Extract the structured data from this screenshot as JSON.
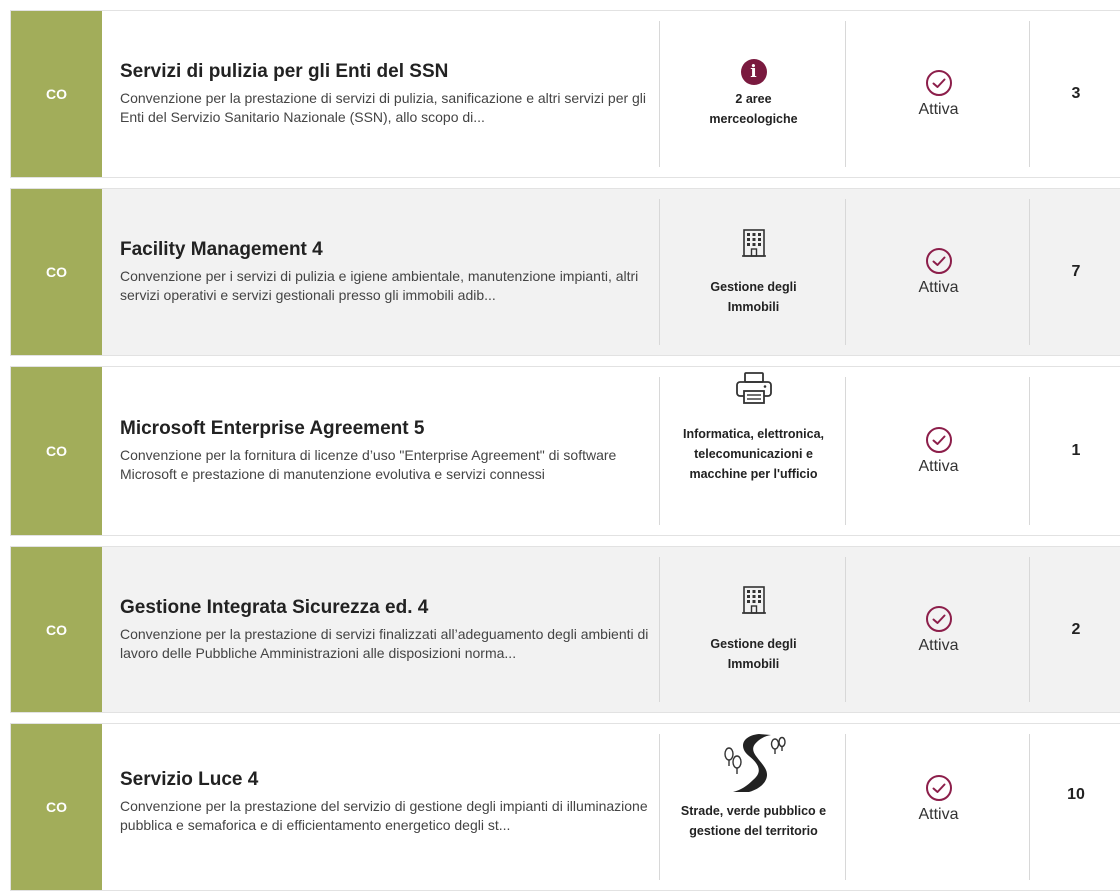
{
  "colors": {
    "co_band": "#a2ad5a",
    "status_icon": "#8c1e4a",
    "info_icon": "#7a1a3f"
  },
  "rows": [
    {
      "type": "CO",
      "title": "Servizi di pulizia per gli Enti del SSN",
      "description": "Convenzione per la prestazione di servizi di pulizia, sanificazione e altri servizi per gli Enti del Servizio Sanitario Nazionale (SSN), allo scopo di...",
      "category_icon": "info-icon",
      "category": "2 aree merceologiche",
      "status": "Attiva",
      "count": "3"
    },
    {
      "type": "CO",
      "title": "Facility Management 4",
      "description": "Convenzione per i servizi di pulizia e igiene ambientale, manutenzione impianti, altri servizi operativi e servizi gestionali presso gli immobili adib...",
      "category_icon": "building-icon",
      "category": "Gestione degli Immobili",
      "status": "Attiva",
      "count": "7"
    },
    {
      "type": "CO",
      "title": "Microsoft Enterprise Agreement 5",
      "description": "Convenzione per la fornitura di licenze d’uso \"Enterprise Agreement\" di software Microsoft e prestazione di manutenzione evolutiva e servizi connessi",
      "category_icon": "printer-icon",
      "category": "Informatica, elettronica, telecomunicazioni e macchine per l'ufficio",
      "status": "Attiva",
      "count": "1"
    },
    {
      "type": "CO",
      "title": "Gestione Integrata Sicurezza ed. 4",
      "description": "Convenzione per la prestazione di servizi finalizzati all’adeguamento degli ambienti di lavoro delle Pubbliche Amministrazioni alle disposizioni norma...",
      "category_icon": "building-icon",
      "category": "Gestione degli Immobili",
      "status": "Attiva",
      "count": "2"
    },
    {
      "type": "CO",
      "title": "Servizio Luce 4",
      "description": "Convenzione per la prestazione del servizio di gestione degli impianti di illuminazione pubblica e semaforica e di efficientamento energetico degli st...",
      "category_icon": "road-trees-icon",
      "category": "Strade, verde pubblico e gestione del territorio",
      "status": "Attiva",
      "count": "10"
    }
  ]
}
